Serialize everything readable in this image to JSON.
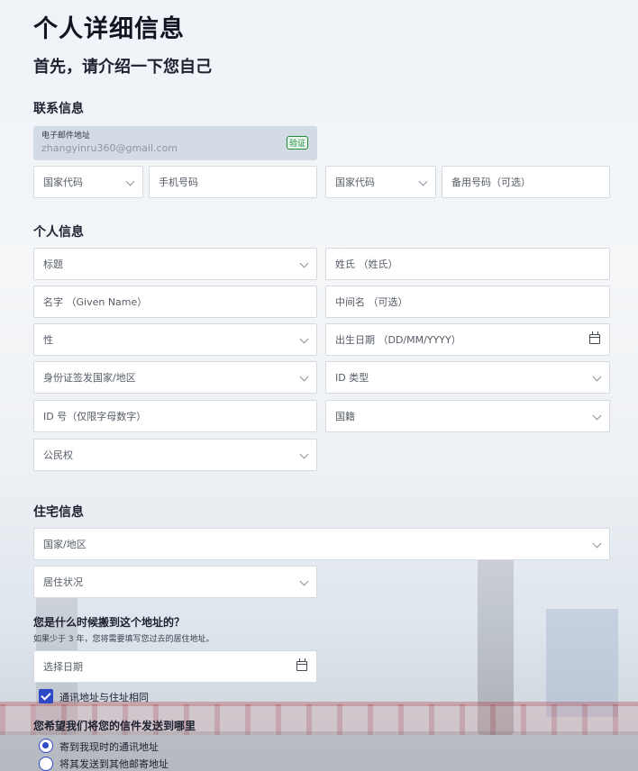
{
  "page": {
    "title": "个人详细信息",
    "subtitle": "首先，请介绍一下您自己"
  },
  "contact": {
    "heading": "联系信息",
    "email_label": "电子邮件地址",
    "email_value": "zhangyinru360@gmail.com",
    "verify_badge": "验证",
    "country_code_1": "国家代码",
    "phone_placeholder": "手机号码",
    "country_code_2": "国家代码",
    "alt_phone_placeholder": "备用号码（可选）"
  },
  "personal": {
    "heading": "个人信息",
    "title_select": "标题",
    "surname": "姓氏 （姓氏）",
    "given_name": "名字 （Given Name）",
    "middle_name": "中间名 （可选）",
    "gender_select": "性",
    "dob": "出生日期 （DD/MM/YYYY）",
    "id_country_select": "身份证签发国家/地区",
    "id_type_select": "ID 类型",
    "id_number": "ID 号（仅限字母数字）",
    "nationality_select": "国籍",
    "citizenship_select": "公民权"
  },
  "residential": {
    "heading": "住宅信息",
    "country_select": "国家/地区",
    "status_select": "居住状况",
    "move_question": "您是什么时候搬到这个地址的？",
    "move_hint": "如果少于 3 年，您将需要填写您过去的居住地址。",
    "date_placeholder": "选择日期",
    "same_address_label": "通讯地址与住址相同",
    "same_address_checked": true,
    "mail_question": "您希望我们将您的信件发送到哪里",
    "mail_options": [
      {
        "label": "寄到我现时的通讯地址",
        "selected": true
      },
      {
        "label": "将其发送到其他邮寄地址",
        "selected": false
      }
    ]
  },
  "colors": {
    "accent": "#2e49c6",
    "verify_green": "#1f8a3b"
  }
}
